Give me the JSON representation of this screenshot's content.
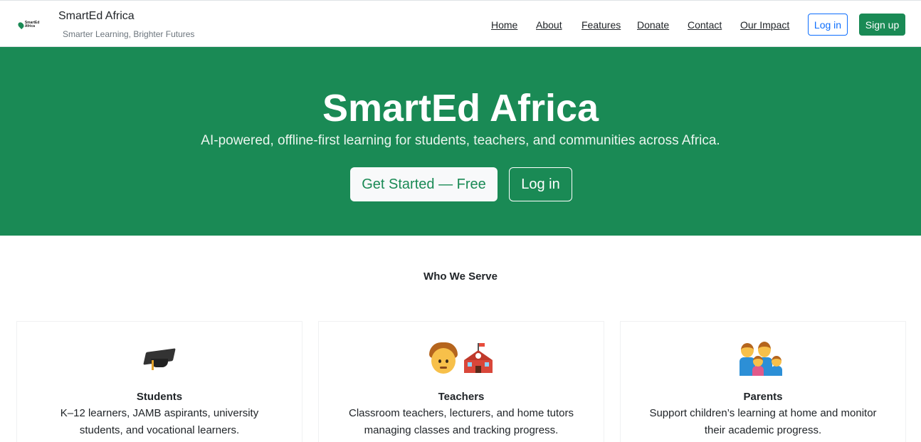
{
  "brand": {
    "logo_text": "SmartEd Africa",
    "name": "SmartEd Africa",
    "tagline": "Smarter Learning, Brighter Futures"
  },
  "nav": {
    "links": [
      {
        "label": "Home"
      },
      {
        "label": "About"
      },
      {
        "label": "Features"
      },
      {
        "label": "Donate"
      },
      {
        "label": "Contact"
      },
      {
        "label": "Our Impact"
      }
    ],
    "login_label": "Log in",
    "signup_label": "Sign up"
  },
  "hero": {
    "title": "SmartEd Africa",
    "subtitle": "AI-powered, offline-first learning for students, teachers, and communities across Africa.",
    "primary_cta": "Get Started — Free",
    "secondary_cta": "Log in"
  },
  "serve": {
    "title": "Who We Serve",
    "cards": [
      {
        "icon": "graduation-cap-icon",
        "title": "Students",
        "text": "K–12 learners, JAMB aspirants, university students, and vocational learners."
      },
      {
        "icon": "teacher-school-icon",
        "title": "Teachers",
        "text": "Classroom teachers, lecturers, and home tutors managing classes and tracking progress."
      },
      {
        "icon": "family-icon",
        "title": "Parents",
        "text": "Support children’s learning at home and monitor their academic progress."
      }
    ]
  },
  "colors": {
    "brand_green": "#1a8a55",
    "link_blue": "#0d6efd"
  }
}
